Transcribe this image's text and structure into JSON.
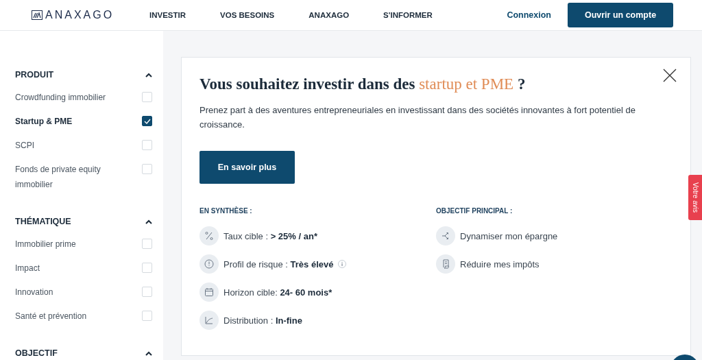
{
  "header": {
    "logo": "ANAXAGO",
    "nav": [
      {
        "label": "INVESTIR"
      },
      {
        "label": "VOS BESOINS"
      },
      {
        "label": "ANAXAGO"
      },
      {
        "label": "S'INFORMER"
      }
    ],
    "login": "Connexion",
    "cta": "Ouvrir un compte"
  },
  "sidebar": {
    "sections": [
      {
        "title": "PRODUIT",
        "expanded": true,
        "items": [
          {
            "label": "Crowdfunding immobilier",
            "checked": false
          },
          {
            "label": "Startup & PME",
            "checked": true
          },
          {
            "label": "SCPI",
            "checked": false
          },
          {
            "label": "Fonds de private equity immobilier",
            "checked": false
          }
        ]
      },
      {
        "title": "THÉMATIQUE",
        "expanded": true,
        "items": [
          {
            "label": "Immobilier prime",
            "checked": false
          },
          {
            "label": "Impact",
            "checked": false
          },
          {
            "label": "Innovation",
            "checked": false
          },
          {
            "label": "Santé et prévention",
            "checked": false
          }
        ]
      },
      {
        "title": "OBJECTIF",
        "expanded": true
      }
    ]
  },
  "card": {
    "title_start": "Vous souhaitez investir dans des ",
    "title_highlight": "startup et PME",
    "title_end": " ?",
    "description": "Prenez part à des aventures entrepreneuriales en investissant dans des sociétés innovantes à fort potentiel de croissance.",
    "button": "En savoir plus",
    "summary": {
      "heading": "EN SYNTHÈSE :",
      "items": [
        {
          "kind": "percent",
          "label": "Taux cible : ",
          "value": "> 25% / an*",
          "info": false
        },
        {
          "kind": "risk",
          "label": "Profil de risque : ",
          "value": "Très élevé",
          "info": true
        },
        {
          "kind": "calendar",
          "label": "Horizon cible: ",
          "value": "24- 60 mois*",
          "info": false
        },
        {
          "kind": "chart",
          "label": "Distribution : ",
          "value": "In-fine",
          "info": false
        }
      ]
    },
    "objective": {
      "heading": "OBJECTIF PRINCIPAL :",
      "items": [
        {
          "kind": "branch",
          "label": "Dynamiser mon épargne"
        },
        {
          "kind": "receipt",
          "label": "Réduire mes impôts"
        }
      ]
    }
  },
  "feedback_tab": "Votre avis"
}
